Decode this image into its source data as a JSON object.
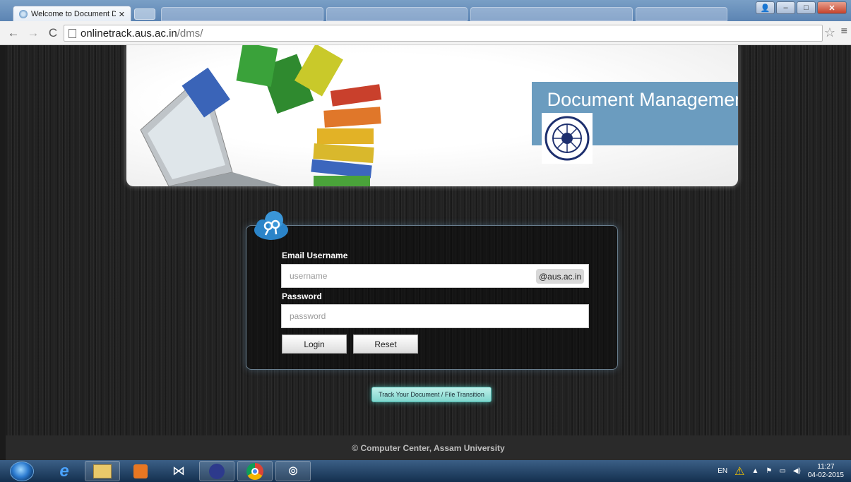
{
  "browser": {
    "tab_title": "Welcome to Document Di",
    "url_host": "onlinetrack.aus.ac.in",
    "url_path": "/dms/"
  },
  "banner": {
    "title": "Document Management System"
  },
  "login": {
    "email_label": "Email Username",
    "username_placeholder": "username",
    "domain_suffix": "@aus.ac.in",
    "password_label": "Password",
    "password_placeholder": "password",
    "login_label": "Login",
    "reset_label": "Reset"
  },
  "track_button": "Track Your Document / File Transition",
  "footer": "© Computer Center, Assam University",
  "taskbar": {
    "lang": "EN",
    "time": "11:27",
    "date": "04-02-2015"
  },
  "colors": {
    "banner_title_bg": "#6b9cbf",
    "track_button": "#7fd6cd"
  }
}
